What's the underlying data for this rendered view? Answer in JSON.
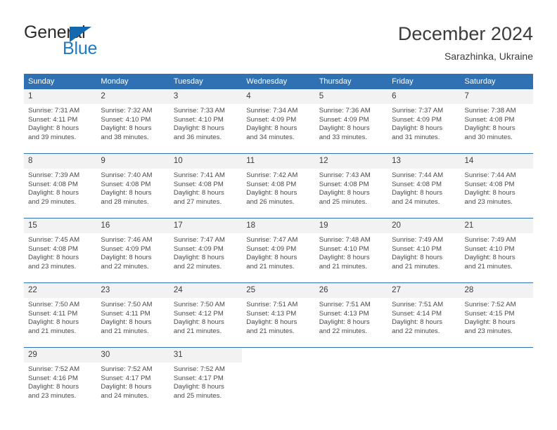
{
  "logo": {
    "primary_text": "General",
    "secondary_text": "Blue",
    "primary_color": "#2b2b2b",
    "secondary_color": "#1f7ac4",
    "triangle_color": "#1368b0",
    "triangle_icon": "triangle-icon"
  },
  "header": {
    "title": "December 2024",
    "subtitle": "Sarazhinka, Ukraine"
  },
  "theme": {
    "header_blue": "#3071b4",
    "daynum_bg": "#f2f2f2",
    "text": "#4a4a4a"
  },
  "calendar": {
    "weekdays": [
      "Sunday",
      "Monday",
      "Tuesday",
      "Wednesday",
      "Thursday",
      "Friday",
      "Saturday"
    ],
    "weeks": [
      [
        {
          "day": "1",
          "sunrise": "Sunrise: 7:31 AM",
          "sunset": "Sunset: 4:11 PM",
          "daylight_line1": "Daylight: 8 hours",
          "daylight_line2": "and 39 minutes."
        },
        {
          "day": "2",
          "sunrise": "Sunrise: 7:32 AM",
          "sunset": "Sunset: 4:10 PM",
          "daylight_line1": "Daylight: 8 hours",
          "daylight_line2": "and 38 minutes."
        },
        {
          "day": "3",
          "sunrise": "Sunrise: 7:33 AM",
          "sunset": "Sunset: 4:10 PM",
          "daylight_line1": "Daylight: 8 hours",
          "daylight_line2": "and 36 minutes."
        },
        {
          "day": "4",
          "sunrise": "Sunrise: 7:34 AM",
          "sunset": "Sunset: 4:09 PM",
          "daylight_line1": "Daylight: 8 hours",
          "daylight_line2": "and 34 minutes."
        },
        {
          "day": "5",
          "sunrise": "Sunrise: 7:36 AM",
          "sunset": "Sunset: 4:09 PM",
          "daylight_line1": "Daylight: 8 hours",
          "daylight_line2": "and 33 minutes."
        },
        {
          "day": "6",
          "sunrise": "Sunrise: 7:37 AM",
          "sunset": "Sunset: 4:09 PM",
          "daylight_line1": "Daylight: 8 hours",
          "daylight_line2": "and 31 minutes."
        },
        {
          "day": "7",
          "sunrise": "Sunrise: 7:38 AM",
          "sunset": "Sunset: 4:08 PM",
          "daylight_line1": "Daylight: 8 hours",
          "daylight_line2": "and 30 minutes."
        }
      ],
      [
        {
          "day": "8",
          "sunrise": "Sunrise: 7:39 AM",
          "sunset": "Sunset: 4:08 PM",
          "daylight_line1": "Daylight: 8 hours",
          "daylight_line2": "and 29 minutes."
        },
        {
          "day": "9",
          "sunrise": "Sunrise: 7:40 AM",
          "sunset": "Sunset: 4:08 PM",
          "daylight_line1": "Daylight: 8 hours",
          "daylight_line2": "and 28 minutes."
        },
        {
          "day": "10",
          "sunrise": "Sunrise: 7:41 AM",
          "sunset": "Sunset: 4:08 PM",
          "daylight_line1": "Daylight: 8 hours",
          "daylight_line2": "and 27 minutes."
        },
        {
          "day": "11",
          "sunrise": "Sunrise: 7:42 AM",
          "sunset": "Sunset: 4:08 PM",
          "daylight_line1": "Daylight: 8 hours",
          "daylight_line2": "and 26 minutes."
        },
        {
          "day": "12",
          "sunrise": "Sunrise: 7:43 AM",
          "sunset": "Sunset: 4:08 PM",
          "daylight_line1": "Daylight: 8 hours",
          "daylight_line2": "and 25 minutes."
        },
        {
          "day": "13",
          "sunrise": "Sunrise: 7:44 AM",
          "sunset": "Sunset: 4:08 PM",
          "daylight_line1": "Daylight: 8 hours",
          "daylight_line2": "and 24 minutes."
        },
        {
          "day": "14",
          "sunrise": "Sunrise: 7:44 AM",
          "sunset": "Sunset: 4:08 PM",
          "daylight_line1": "Daylight: 8 hours",
          "daylight_line2": "and 23 minutes."
        }
      ],
      [
        {
          "day": "15",
          "sunrise": "Sunrise: 7:45 AM",
          "sunset": "Sunset: 4:08 PM",
          "daylight_line1": "Daylight: 8 hours",
          "daylight_line2": "and 23 minutes."
        },
        {
          "day": "16",
          "sunrise": "Sunrise: 7:46 AM",
          "sunset": "Sunset: 4:09 PM",
          "daylight_line1": "Daylight: 8 hours",
          "daylight_line2": "and 22 minutes."
        },
        {
          "day": "17",
          "sunrise": "Sunrise: 7:47 AM",
          "sunset": "Sunset: 4:09 PM",
          "daylight_line1": "Daylight: 8 hours",
          "daylight_line2": "and 22 minutes."
        },
        {
          "day": "18",
          "sunrise": "Sunrise: 7:47 AM",
          "sunset": "Sunset: 4:09 PM",
          "daylight_line1": "Daylight: 8 hours",
          "daylight_line2": "and 21 minutes."
        },
        {
          "day": "19",
          "sunrise": "Sunrise: 7:48 AM",
          "sunset": "Sunset: 4:10 PM",
          "daylight_line1": "Daylight: 8 hours",
          "daylight_line2": "and 21 minutes."
        },
        {
          "day": "20",
          "sunrise": "Sunrise: 7:49 AM",
          "sunset": "Sunset: 4:10 PM",
          "daylight_line1": "Daylight: 8 hours",
          "daylight_line2": "and 21 minutes."
        },
        {
          "day": "21",
          "sunrise": "Sunrise: 7:49 AM",
          "sunset": "Sunset: 4:10 PM",
          "daylight_line1": "Daylight: 8 hours",
          "daylight_line2": "and 21 minutes."
        }
      ],
      [
        {
          "day": "22",
          "sunrise": "Sunrise: 7:50 AM",
          "sunset": "Sunset: 4:11 PM",
          "daylight_line1": "Daylight: 8 hours",
          "daylight_line2": "and 21 minutes."
        },
        {
          "day": "23",
          "sunrise": "Sunrise: 7:50 AM",
          "sunset": "Sunset: 4:11 PM",
          "daylight_line1": "Daylight: 8 hours",
          "daylight_line2": "and 21 minutes."
        },
        {
          "day": "24",
          "sunrise": "Sunrise: 7:50 AM",
          "sunset": "Sunset: 4:12 PM",
          "daylight_line1": "Daylight: 8 hours",
          "daylight_line2": "and 21 minutes."
        },
        {
          "day": "25",
          "sunrise": "Sunrise: 7:51 AM",
          "sunset": "Sunset: 4:13 PM",
          "daylight_line1": "Daylight: 8 hours",
          "daylight_line2": "and 21 minutes."
        },
        {
          "day": "26",
          "sunrise": "Sunrise: 7:51 AM",
          "sunset": "Sunset: 4:13 PM",
          "daylight_line1": "Daylight: 8 hours",
          "daylight_line2": "and 22 minutes."
        },
        {
          "day": "27",
          "sunrise": "Sunrise: 7:51 AM",
          "sunset": "Sunset: 4:14 PM",
          "daylight_line1": "Daylight: 8 hours",
          "daylight_line2": "and 22 minutes."
        },
        {
          "day": "28",
          "sunrise": "Sunrise: 7:52 AM",
          "sunset": "Sunset: 4:15 PM",
          "daylight_line1": "Daylight: 8 hours",
          "daylight_line2": "and 23 minutes."
        }
      ],
      [
        {
          "day": "29",
          "sunrise": "Sunrise: 7:52 AM",
          "sunset": "Sunset: 4:16 PM",
          "daylight_line1": "Daylight: 8 hours",
          "daylight_line2": "and 23 minutes."
        },
        {
          "day": "30",
          "sunrise": "Sunrise: 7:52 AM",
          "sunset": "Sunset: 4:17 PM",
          "daylight_line1": "Daylight: 8 hours",
          "daylight_line2": "and 24 minutes."
        },
        {
          "day": "31",
          "sunrise": "Sunrise: 7:52 AM",
          "sunset": "Sunset: 4:17 PM",
          "daylight_line1": "Daylight: 8 hours",
          "daylight_line2": "and 25 minutes."
        },
        {
          "day": "",
          "sunrise": "",
          "sunset": "",
          "daylight_line1": "",
          "daylight_line2": ""
        },
        {
          "day": "",
          "sunrise": "",
          "sunset": "",
          "daylight_line1": "",
          "daylight_line2": ""
        },
        {
          "day": "",
          "sunrise": "",
          "sunset": "",
          "daylight_line1": "",
          "daylight_line2": ""
        },
        {
          "day": "",
          "sunrise": "",
          "sunset": "",
          "daylight_line1": "",
          "daylight_line2": ""
        }
      ]
    ]
  }
}
